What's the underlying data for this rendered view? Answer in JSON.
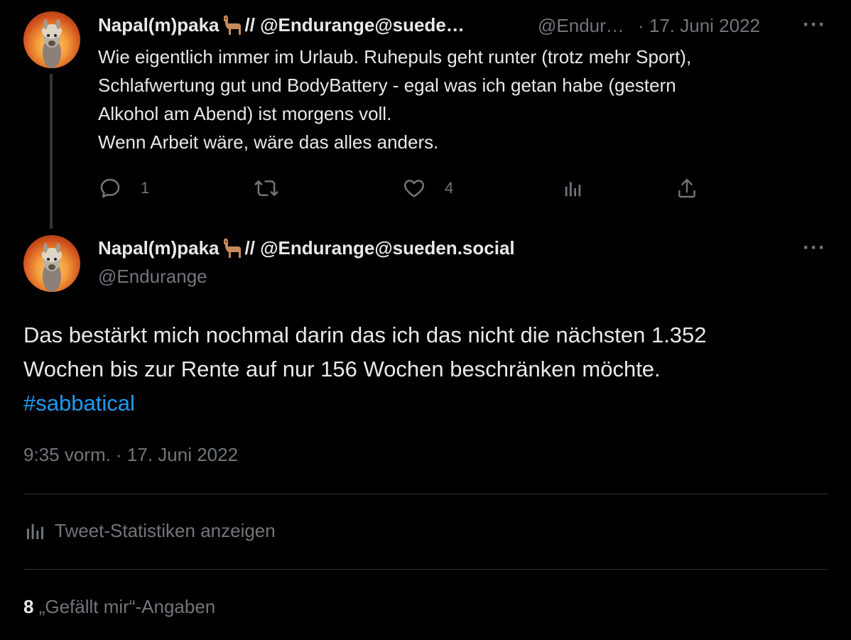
{
  "reply_tweet": {
    "display_name": "Napal(m)paka",
    "name_suffix": " // @Endurange@suede…",
    "handle": "@Endur…",
    "date": "· 17. Juni 2022",
    "text": "Wie eigentlich immer im Urlaub. Ruhepuls geht runter (trotz mehr Sport),\nSchlafwertung gut und BodyBattery - egal was ich getan habe (gestern\nAlkohol am Abend) ist morgens voll.\nWenn Arbeit wäre, wäre das alles anders.",
    "reply_count": "1",
    "like_count": "4",
    "more": "···"
  },
  "main_tweet": {
    "display_name": "Napal(m)paka",
    "name_suffix": " // @Endurange@sueden.social",
    "handle": "@Endurange",
    "text_line1": "Das bestärkt mich nochmal darin das ich das nicht die nächsten 1.352",
    "text_line2": "Wochen bis zur Rente auf nur 156 Wochen beschränken möchte.",
    "hashtag": "#sabbatical",
    "timestamp": "9:35 vorm. · 17. Juni 2022",
    "more": "···",
    "stats_link": "Tweet-Statistiken anzeigen",
    "likes_count": "8",
    "likes_label": "„Gefällt mir“-Angaben"
  },
  "icons": {
    "reply": "reply-icon",
    "retweet": "retweet-icon",
    "like": "heart-icon",
    "views": "analytics-icon",
    "share": "share-icon",
    "emoji": "llama-emoji"
  },
  "colors": {
    "background": "#000000",
    "text": "#e7e9ea",
    "muted": "#71767b",
    "link": "#1d9bf0",
    "divider": "#2f3336"
  }
}
